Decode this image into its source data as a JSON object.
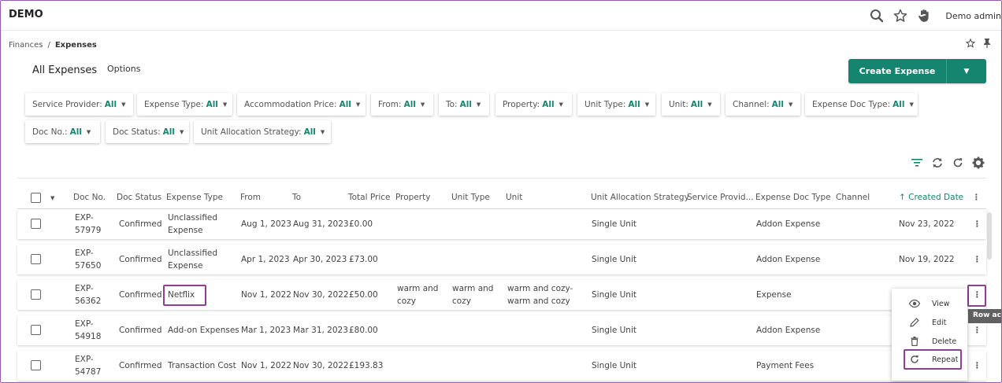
{
  "app": {
    "brand": "DEMO",
    "user": "Demo admin"
  },
  "breadcrumb": {
    "parent": "Finances",
    "sep": "/",
    "current": "Expenses"
  },
  "page": {
    "title": "All Expenses",
    "options": "Options",
    "create_label": "Create Expense"
  },
  "filters": [
    {
      "label": "Service Provider:",
      "value": "All"
    },
    {
      "label": "Expense Type:",
      "value": "All"
    },
    {
      "label": "Accommodation Price:",
      "value": "All"
    },
    {
      "label": "From:",
      "value": "All"
    },
    {
      "label": "To:",
      "value": "All"
    },
    {
      "label": "Property:",
      "value": "All"
    },
    {
      "label": "Unit Type:",
      "value": "All"
    },
    {
      "label": "Unit:",
      "value": "All"
    },
    {
      "label": "Channel:",
      "value": "All"
    },
    {
      "label": "Expense Doc Type:",
      "value": "All"
    },
    {
      "label": "Doc No.:",
      "value": "All"
    },
    {
      "label": "Doc Status:",
      "value": "All"
    },
    {
      "label": "Unit Allocation Strategy:",
      "value": "All"
    }
  ],
  "columns": [
    "Doc No.",
    "Doc Status",
    "Expense Type",
    "From",
    "To",
    "Total Price",
    "Property",
    "Unit Type",
    "Unit",
    "Unit Allocation Strategy",
    "Service Provid...",
    "Expense Doc Type",
    "Channel",
    "Created Date"
  ],
  "rows": [
    {
      "doc1": "EXP-",
      "doc2": "57979",
      "status": "Confirmed",
      "type1": "Unclassified",
      "type2": "Expense",
      "from": "Aug 1, 2023",
      "to": "Aug 31, 2023",
      "price": "£0.00",
      "prop1": "",
      "prop2": "",
      "ut1": "",
      "ut2": "",
      "unit1": "",
      "unit2": "",
      "strategy": "Single Unit",
      "doctype": "Addon Expense",
      "created": "Nov 23, 2022"
    },
    {
      "doc1": "EXP-",
      "doc2": "57650",
      "status": "Confirmed",
      "type1": "Unclassified",
      "type2": "Expense",
      "from": "Apr 1, 2023",
      "to": "Apr 30, 2023",
      "price": "£73.00",
      "prop1": "",
      "prop2": "",
      "ut1": "",
      "ut2": "",
      "unit1": "",
      "unit2": "",
      "strategy": "Single Unit",
      "doctype": "Addon Expense",
      "created": "Nov 19, 2022"
    },
    {
      "doc1": "EXP-",
      "doc2": "56362",
      "status": "Confirmed",
      "type1": "Netflix",
      "type2": "",
      "from": "Nov 1, 2022",
      "to": "Nov 30, 2022",
      "price": "£50.00",
      "prop1": "warm and",
      "prop2": "cozy",
      "ut1": "warm and",
      "ut2": "cozy",
      "unit1": "warm and cozy-",
      "unit2": "warm and cozy",
      "strategy": "Single Unit",
      "doctype": "Expense",
      "created": ""
    },
    {
      "doc1": "EXP-",
      "doc2": "54918",
      "status": "Confirmed",
      "type1": "Add-on Expenses",
      "type2": "",
      "from": "Mar 1, 2023",
      "to": "Mar 31, 2023",
      "price": "£80.00",
      "prop1": "",
      "prop2": "",
      "ut1": "",
      "ut2": "",
      "unit1": "",
      "unit2": "",
      "strategy": "Single Unit",
      "doctype": "Addon Expense",
      "created": ""
    },
    {
      "doc1": "EXP-",
      "doc2": "54787",
      "status": "Confirmed",
      "type1": "Transaction Cost",
      "type2": "",
      "from": "Nov 1, 2022",
      "to": "Nov 30, 2022",
      "price": "£193.83",
      "prop1": "",
      "prop2": "",
      "ut1": "",
      "ut2": "",
      "unit1": "",
      "unit2": "",
      "strategy": "Single Unit",
      "doctype": "Payment Fees",
      "created": ""
    }
  ],
  "row_menu": {
    "view": "View",
    "edit": "Edit",
    "delete": "Delete",
    "repeat": "Repeat"
  },
  "tooltip": "Row actions",
  "colors": {
    "accent": "#16856f",
    "highlight": "#8e3f93"
  },
  "icons": [
    "search-icon",
    "star-icon",
    "hand-icon",
    "pin-icon",
    "filter-icon",
    "sync-icon",
    "refresh-icon",
    "gear-icon",
    "kebab-icon",
    "eye-icon",
    "pencil-icon",
    "trash-icon",
    "repeat-icon",
    "chevron-down-icon",
    "arrow-up-icon"
  ]
}
